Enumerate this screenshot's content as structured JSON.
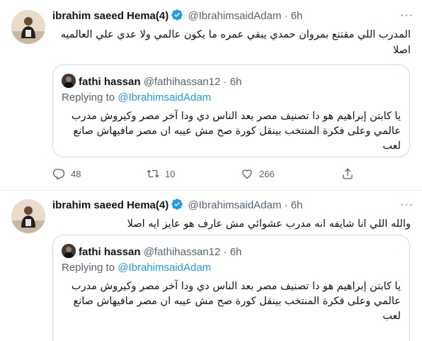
{
  "tweets": [
    {
      "author_name": "ibrahim saeed Hema(4)",
      "author_handle": "@IbrahimsaidAdam",
      "separator": "·",
      "time": "6h",
      "text": "المدرب اللي مقتنع بمروان حمدي يبقي عمره ما يكون عالمي ولا عدي علي العالميه اصلا",
      "quote": {
        "author_name": "fathi hassan",
        "author_handle": "@fathihassan12",
        "separator": "·",
        "time": "6h",
        "replying_label": "Replying to",
        "replying_to": "@IbrahimsaidAdam",
        "text": "يا كابتن إبراهيم هو دا تصنيف مصر بعد الناس دي ودا آخر مصر وكيروش مدرب عالمي وعلى فكرة المنتخب بينقل كورة صح مش عيبه ان مصر مافيهاش صانع لعب"
      },
      "actions": {
        "replies": "48",
        "retweets": "10",
        "likes": "266"
      }
    },
    {
      "author_name": "ibrahim saeed Hema(4)",
      "author_handle": "@IbrahimsaidAdam",
      "separator": "·",
      "time": "6h",
      "text": "والله اللي انا شايفه انه مدرب عشوائي مش عارف هو عايز ايه اصلا",
      "quote": {
        "author_name": "fathi hassan",
        "author_handle": "@fathihassan12",
        "separator": "·",
        "time": "6h",
        "replying_label": "Replying to",
        "replying_to": "@IbrahimsaidAdam",
        "text": "يا كابتن إبراهيم هو دا تصنيف مصر بعد الناس دي ودا آخر مصر وكيروش مدرب عالمي وعلى فكرة المنتخب بينقل كورة صح مش عيبه ان مصر مافيهاش صانع لعب"
      }
    }
  ],
  "more_glyph": "···",
  "colors": {
    "accent": "#1d9bf0",
    "muted": "#536471",
    "border": "#cfd9de"
  },
  "icons": [
    "verified-badge-icon",
    "more-icon",
    "reply-icon",
    "retweet-icon",
    "like-icon",
    "share-icon"
  ]
}
